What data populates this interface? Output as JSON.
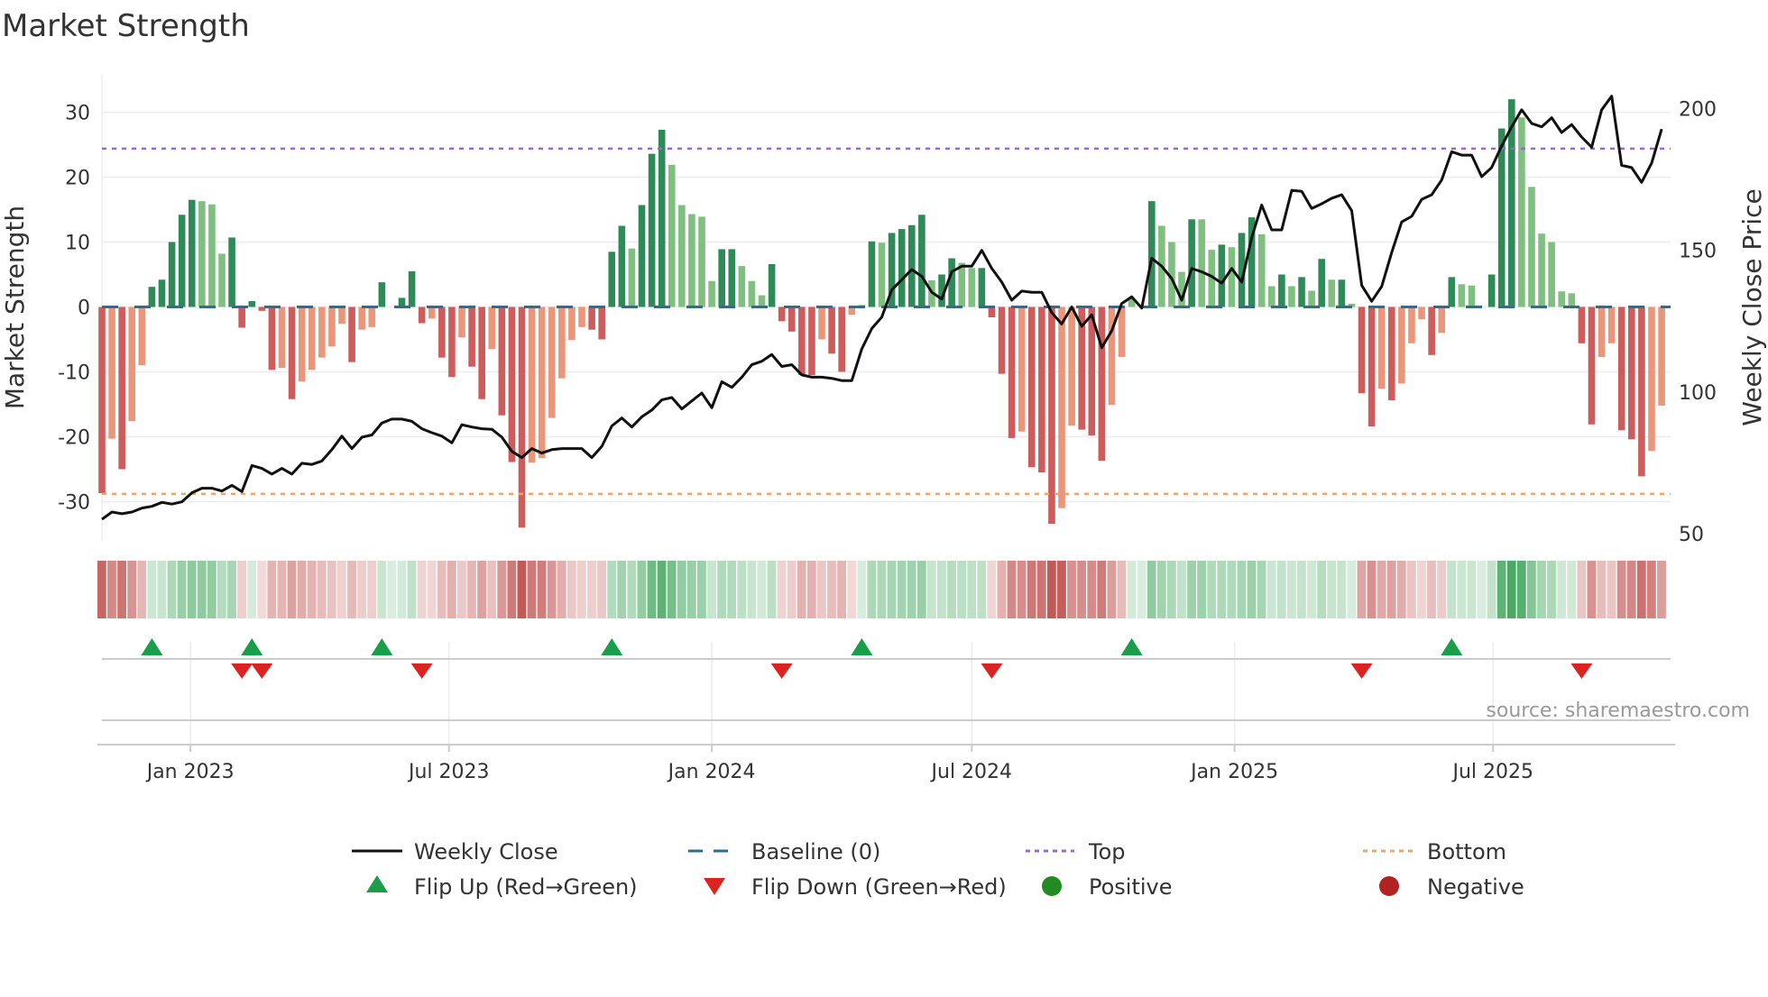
{
  "chart_data": {
    "type": "bar",
    "title": "Market Strength",
    "ylabel": "Market Strength",
    "y2label": "Weekly Close Price",
    "ylim": [
      -36,
      36
    ],
    "y2lim": [
      47.5,
      212.5
    ],
    "y_ticks": [
      30,
      20,
      10,
      0,
      -10,
      -20,
      -30
    ],
    "y2_ticks": [
      200,
      150,
      100,
      50
    ],
    "x_ticks": [
      {
        "label": "Jan 2023",
        "date": "2023-01-01"
      },
      {
        "label": "Jul 2023",
        "date": "2023-07-01"
      },
      {
        "label": "Jan 2024",
        "date": "2024-01-01"
      },
      {
        "label": "Jul 2024",
        "date": "2024-07-01"
      },
      {
        "label": "Jan 2025",
        "date": "2025-01-01"
      },
      {
        "label": "Jul 2025",
        "date": "2025-07-01"
      }
    ],
    "start_date": "2022-10-31",
    "frequency": "weekly",
    "top_level": 24.4,
    "bottom_level": -28.8,
    "baseline": 0,
    "strength": [
      -28.7,
      -20.3,
      -25,
      -17.6,
      -9,
      3.1,
      4.2,
      10,
      14.2,
      16.5,
      16.3,
      15.8,
      8.2,
      10.7,
      -3.2,
      0.9,
      -0.6,
      -9.7,
      -9.4,
      -14.2,
      -11.5,
      -9.7,
      -7.8,
      -6.1,
      -2.6,
      -8.5,
      -3.5,
      -3.1,
      3.8,
      0,
      1.4,
      5.5,
      -2.5,
      -1.8,
      -7.8,
      -10.8,
      -4.7,
      -9.2,
      -14.2,
      -6.5,
      -16.7,
      -23.9,
      -34,
      -24,
      -23.3,
      -17.1,
      -11,
      -5.1,
      -3.1,
      -3.5,
      -5,
      8.5,
      12.5,
      9,
      15.7,
      23.6,
      27.3,
      21.9,
      15.7,
      14.3,
      13.9,
      4,
      8.9,
      8.9,
      6.3,
      4,
      1.8,
      6.6,
      -2.2,
      -3.8,
      -10.5,
      -10.5,
      -5,
      -7.2,
      -10,
      -1.2,
      0.3,
      10.1,
      9.9,
      11.4,
      12,
      12.6,
      14.2,
      4.1,
      5,
      7.5,
      6.8,
      6,
      6,
      -1.6,
      -10.3,
      -20.2,
      -19.2,
      -24.7,
      -25.5,
      -33.4,
      -31,
      -18.3,
      -18.9,
      -19.8,
      -23.7,
      -15.1,
      -7.7,
      1.3,
      0,
      16.3,
      12.5,
      10,
      5.4,
      13.5,
      13.5,
      8.8,
      9.6,
      9.2,
      11.4,
      13.8,
      11.2,
      3.2,
      5,
      3.2,
      4.6,
      2.5,
      7.4,
      4.2,
      4.2,
      0.5,
      -13.3,
      -18.4,
      -12.6,
      -14.4,
      -11.8,
      -5.6,
      -1.9,
      -7.4,
      -4,
      4.6,
      3.5,
      3.3,
      0,
      5,
      27.5,
      32,
      29.2,
      18.5,
      11.3,
      10,
      2.4,
      2.1,
      -5.6,
      -18.1,
      -7.7,
      -5.6,
      -19,
      -20.4,
      -26.1,
      -22.2,
      -15.2
    ],
    "strengthening": [
      1,
      0,
      1,
      0,
      0,
      1,
      1,
      1,
      1,
      1,
      0,
      0,
      0,
      1,
      1,
      1,
      1,
      1,
      0,
      1,
      0,
      0,
      0,
      0,
      0,
      1,
      0,
      0,
      1,
      1,
      1,
      1,
      1,
      0,
      1,
      1,
      0,
      1,
      1,
      0,
      1,
      1,
      1,
      0,
      0,
      0,
      0,
      0,
      0,
      1,
      1,
      1,
      1,
      0,
      1,
      1,
      1,
      0,
      0,
      0,
      0,
      0,
      1,
      1,
      0,
      0,
      0,
      1,
      1,
      1,
      1,
      1,
      0,
      1,
      1,
      0,
      0,
      1,
      0,
      1,
      1,
      1,
      1,
      0,
      1,
      1,
      0,
      0,
      1,
      1,
      1,
      1,
      0,
      1,
      1,
      1,
      0,
      0,
      1,
      1,
      1,
      0,
      0,
      0,
      0,
      1,
      0,
      0,
      0,
      1,
      0,
      0,
      1,
      0,
      1,
      1,
      0,
      0,
      1,
      0,
      1,
      0,
      1,
      0,
      1,
      0,
      1,
      1,
      0,
      1,
      0,
      0,
      0,
      1,
      0,
      1,
      0,
      0,
      1,
      1,
      1,
      1,
      0,
      0,
      0,
      0,
      0,
      0,
      1,
      1,
      0,
      0,
      1,
      1,
      1,
      0,
      0
    ],
    "weekly_close": [
      55,
      57.6,
      57,
      57.6,
      59,
      59.6,
      61,
      60.4,
      61.2,
      64.4,
      66,
      66,
      65,
      67,
      64.8,
      74,
      73,
      71,
      73,
      71,
      74.8,
      74.4,
      75.6,
      79.6,
      84.4,
      80,
      84,
      84.8,
      89,
      90.4,
      90.4,
      89.6,
      87,
      85.6,
      84.4,
      82,
      88.4,
      87.6,
      87,
      86.8,
      84,
      79,
      76.8,
      80,
      78.4,
      79.6,
      80,
      80,
      80,
      76.8,
      80.8,
      88,
      90.8,
      87.6,
      91.2,
      93.6,
      97.2,
      98,
      94,
      96.8,
      99.6,
      94.4,
      103.6,
      101.6,
      105.2,
      109.6,
      110.8,
      113.2,
      109,
      109.6,
      106,
      105.2,
      105.2,
      104.8,
      104,
      104,
      115.2,
      122.4,
      126.4,
      136,
      139.6,
      143.2,
      140.8,
      135.2,
      132.8,
      142.4,
      144.4,
      144.4,
      150,
      143.6,
      138.8,
      132.4,
      135.6,
      135.2,
      135.2,
      128,
      124,
      130,
      123.2,
      127.2,
      115.6,
      121.6,
      131.2,
      133.6,
      129.6,
      147.2,
      144.4,
      140,
      132.4,
      143.6,
      142.4,
      140.8,
      138.4,
      143.6,
      138.8,
      154.4,
      166,
      157.2,
      157.2,
      171.2,
      170.8,
      164.8,
      166.4,
      168.4,
      169.6,
      164,
      137.6,
      132,
      137.2,
      149.2,
      160,
      162,
      168,
      169.6,
      174.8,
      184.8,
      183.6,
      183.6,
      176,
      179.2,
      186.8,
      193.6,
      199.6,
      194.8,
      193.6,
      196.8,
      191.6,
      194.4,
      190,
      186.4,
      199.6,
      204.4,
      180,
      179.2,
      174,
      180.8,
      192.8
    ],
    "flip_up_week_index": [
      5,
      15,
      28,
      51,
      76,
      103,
      135
    ],
    "flip_down_week_index": [
      14,
      16,
      32,
      68,
      89,
      126,
      148
    ],
    "legend": [
      {
        "label": "Weekly Close",
        "symbol": "solid-line"
      },
      {
        "label": "Baseline (0)",
        "symbol": "dashed-line"
      },
      {
        "label": "Top",
        "symbol": "dotted-line"
      },
      {
        "label": "Bottom",
        "symbol": "dotted-line"
      },
      {
        "label": "Flip Up (Red→Green)",
        "symbol": "triangle-up"
      },
      {
        "label": "Flip Down (Green→Red)",
        "symbol": "triangle-down"
      },
      {
        "label": "Positive",
        "symbol": "circle"
      },
      {
        "label": "Negative",
        "symbol": "circle"
      }
    ],
    "legend_placement": "bottom",
    "source": "source: sharemaestro.com",
    "colors": {
      "pos_strong": "#2e8b57",
      "pos_weak": "#7fbf7f",
      "neg_strong": "#cd5c5c",
      "neg_weak": "#e9967a",
      "price": "#111111",
      "baseline": "#2a6f97",
      "top": "#9966dd",
      "bottom": "#f4a460",
      "flip_up": "#1a9e4a",
      "flip_down": "#dd2222",
      "positive": "#228b22",
      "negative": "#b22222"
    }
  }
}
